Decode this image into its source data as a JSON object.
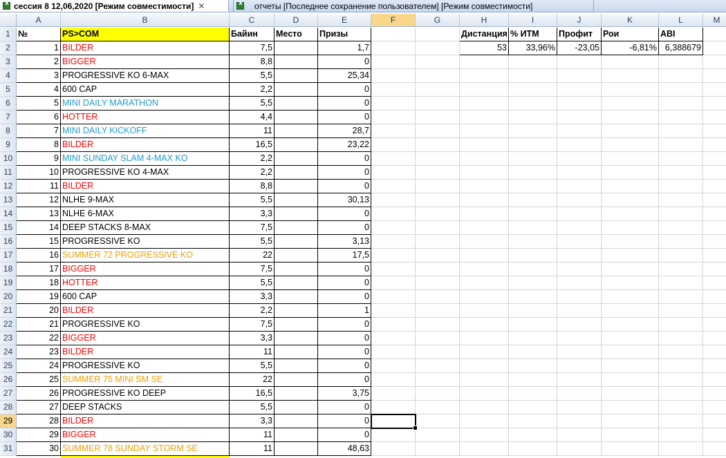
{
  "tabs": [
    {
      "label": "сессия 8 12,06,2020  [Режим совместимости]",
      "active": true
    },
    {
      "label": "отчеты [Последнее сохранение пользователем]  [Режим совместимости]",
      "active": false
    }
  ],
  "close_glyph": "✕",
  "columns": [
    "A",
    "B",
    "C",
    "D",
    "E",
    "F",
    "G",
    "H",
    "I",
    "J",
    "K",
    "L",
    "M"
  ],
  "header_row": {
    "no": "№",
    "name": "PS>COM",
    "buyin": "Байин",
    "place": "Место",
    "prize": "Призы"
  },
  "stats_headers": {
    "distance": "Дистанция",
    "itm": "% ИТМ",
    "profit": "Профит",
    "roi": "Рои",
    "abi": "ABI"
  },
  "stats_values": {
    "distance": "53",
    "itm": "33,96%",
    "profit": "-23,05",
    "roi": "-6,81%",
    "abi": "6,388679"
  },
  "rows": [
    {
      "no": "1",
      "name": "BILDER",
      "color": "red",
      "buyin": "7,5",
      "prize": "1,7"
    },
    {
      "no": "2",
      "name": "BIGGER",
      "color": "red",
      "buyin": "8,8",
      "prize": "0"
    },
    {
      "no": "3",
      "name": "PROGRESSIVE KO 6-MAX",
      "color": "black",
      "buyin": "5,5",
      "prize": "25,34"
    },
    {
      "no": "4",
      "name": "600 CAP",
      "color": "black",
      "buyin": "2,2",
      "prize": "0"
    },
    {
      "no": "5",
      "name": "MINI DAILY MARATHON",
      "color": "blue",
      "buyin": "5,5",
      "prize": "0"
    },
    {
      "no": "6",
      "name": "HOTTER",
      "color": "red",
      "buyin": "4,4",
      "prize": "0"
    },
    {
      "no": "7",
      "name": "MINI DAILY KICKOFF",
      "color": "blue",
      "buyin": "11",
      "prize": "28,7"
    },
    {
      "no": "8",
      "name": "BILDER",
      "color": "red",
      "buyin": "16,5",
      "prize": "23,22"
    },
    {
      "no": "9",
      "name": "MINI SUNDAY SLAM 4-MAX KO",
      "color": "blue",
      "buyin": "2,2",
      "prize": "0"
    },
    {
      "no": "10",
      "name": "PROGRESSIVE KO 4-MAX",
      "color": "black",
      "buyin": "2,2",
      "prize": "0"
    },
    {
      "no": "11",
      "name": "BILDER",
      "color": "red",
      "buyin": "8,8",
      "prize": "0"
    },
    {
      "no": "12",
      "name": "NLHE 9-MAX",
      "color": "black",
      "buyin": "5,5",
      "prize": "30,13"
    },
    {
      "no": "13",
      "name": "NLHE 6-MAX",
      "color": "black",
      "buyin": "3,3",
      "prize": "0"
    },
    {
      "no": "14",
      "name": "DEEP STACKS 8-MAX",
      "color": "black",
      "buyin": "7,5",
      "prize": "0"
    },
    {
      "no": "15",
      "name": "PROGRESSIVE KO",
      "color": "black",
      "buyin": "5,5",
      "prize": "3,13"
    },
    {
      "no": "16",
      "name": "SUMMER 72 PROGRESSIVE KO",
      "color": "orange",
      "buyin": "22",
      "prize": "17,5"
    },
    {
      "no": "17",
      "name": "BIGGER",
      "color": "red",
      "buyin": "7,5",
      "prize": "0"
    },
    {
      "no": "18",
      "name": "HOTTER",
      "color": "red",
      "buyin": "5,5",
      "prize": "0"
    },
    {
      "no": "19",
      "name": "600 CAP",
      "color": "black",
      "buyin": "3,3",
      "prize": "0"
    },
    {
      "no": "20",
      "name": "BILDER",
      "color": "red",
      "buyin": "2,2",
      "prize": "1"
    },
    {
      "no": "21",
      "name": "PROGRESSIVE KO",
      "color": "black",
      "buyin": "7,5",
      "prize": "0"
    },
    {
      "no": "22",
      "name": "BIGGER",
      "color": "red",
      "buyin": "3,3",
      "prize": "0"
    },
    {
      "no": "23",
      "name": "BILDER",
      "color": "red",
      "buyin": "11",
      "prize": "0"
    },
    {
      "no": "24",
      "name": "PROGRESSIVE KO",
      "color": "black",
      "buyin": "5,5",
      "prize": "0"
    },
    {
      "no": "25",
      "name": "SUMMER 75 MINI  SM SE",
      "color": "orange",
      "buyin": "22",
      "prize": "0"
    },
    {
      "no": "26",
      "name": "PROGRESSIVE KO DEEP",
      "color": "black",
      "buyin": "16,5",
      "prize": "3,75"
    },
    {
      "no": "27",
      "name": "DEEP STACKS",
      "color": "black",
      "buyin": "5,5",
      "prize": "0"
    },
    {
      "no": "28",
      "name": "BILDER",
      "color": "red",
      "buyin": "3,3",
      "prize": "0"
    },
    {
      "no": "29",
      "name": "BIGGER",
      "color": "red",
      "buyin": "11",
      "prize": "0"
    },
    {
      "no": "30",
      "name": "SUMMER 78 SUNDAY STORM SE",
      "color": "orange",
      "buyin": "11",
      "prize": "48,63"
    }
  ],
  "selected_row": "29",
  "selected_col": "F",
  "colors": {
    "red": "#ff0000",
    "blue": "#1f9bd4",
    "orange": "#f0a000",
    "yellow": "#ffff00"
  }
}
